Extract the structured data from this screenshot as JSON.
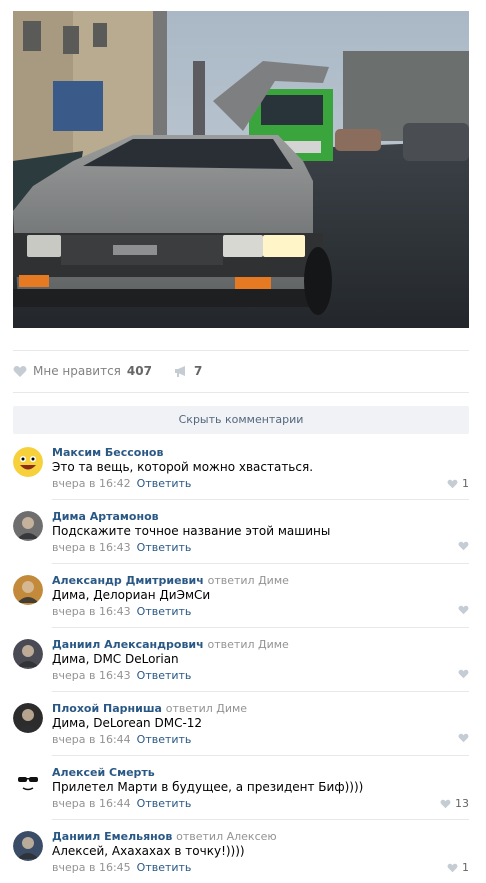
{
  "post": {
    "likes_label": "Мне нравится",
    "likes_count": "407",
    "shares_count": "7",
    "hide_comments_label": "Скрыть комментарии"
  },
  "comments": [
    {
      "author": "Максим Бессонов",
      "reply_to": "",
      "text": "Это та вещь, которой можно хвастаться.",
      "time": "вчера в 16:42",
      "answer": "Ответить",
      "likes": "1",
      "avatar": "smiley-face-icon"
    },
    {
      "author": "Дима Артамонов",
      "reply_to": "",
      "text": "Подскажите точное название этой машины",
      "time": "вчера в 16:43",
      "answer": "Ответить",
      "likes": "",
      "avatar": "user-photo"
    },
    {
      "author": "Александр Дмитриевич",
      "reply_to": "ответил Диме",
      "text": "Дима, Делориан ДиЭмСи",
      "time": "вчера в 16:43",
      "answer": "Ответить",
      "likes": "",
      "avatar": "user-photo"
    },
    {
      "author": "Даниил Александрович",
      "reply_to": "ответил Диме",
      "text": "Дима, DMC DeLorian",
      "time": "вчера в 16:43",
      "answer": "Ответить",
      "likes": "",
      "avatar": "user-photo"
    },
    {
      "author": "Плохой Парниша",
      "reply_to": "ответил Диме",
      "text": "Дима, DeLorean DMC-12",
      "time": "вчера в 16:44",
      "answer": "Ответить",
      "likes": "",
      "avatar": "user-photo"
    },
    {
      "author": "Алексей Смерть",
      "reply_to": "",
      "text": "Прилетел Марти в будущее, а президент Биф))))",
      "time": "вчера в 16:44",
      "answer": "Ответить",
      "likes": "13",
      "avatar": "sunglasses-face-icon"
    },
    {
      "author": "Даниил Емельянов",
      "reply_to": "ответил Алексею",
      "text": "Алексей, Ахахахах в точку!))))",
      "time": "вчера в 16:45",
      "answer": "Ответить",
      "likes": "1",
      "avatar": "user-photo"
    }
  ],
  "colors": {
    "link": "#2a5885",
    "muted": "#939393",
    "bar": "#f0f2f5"
  }
}
